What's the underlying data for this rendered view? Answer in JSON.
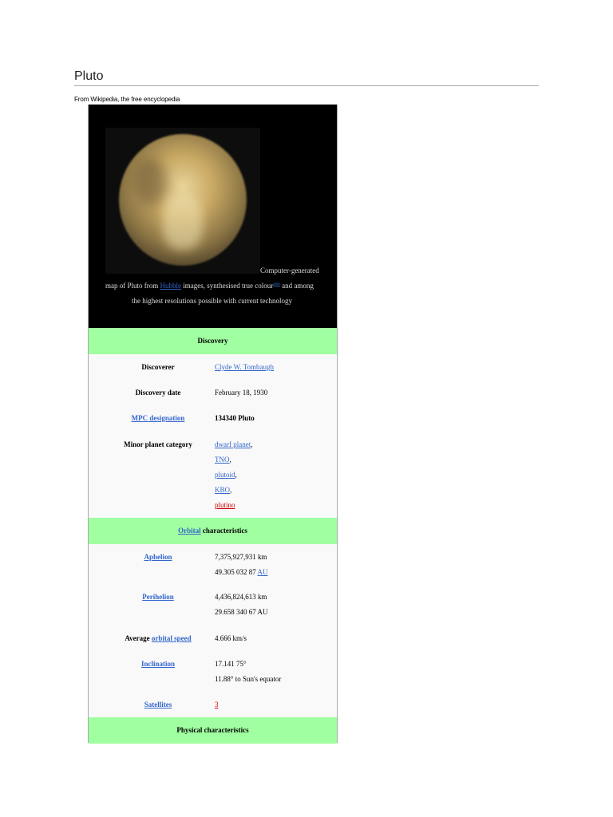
{
  "page": {
    "title": "Pluto",
    "subtitle": "From Wikipedia, the free encyclopedia"
  },
  "infobox": {
    "caption": {
      "line1": "Computer-generated",
      "line2_pre": "map of Pluto from ",
      "hubble": "Hubble",
      "line2_mid": " images, synthesised true colour",
      "note": "note",
      "line2_post": " and among",
      "line3": "the highest resolutions possible with current technology"
    },
    "discovery": {
      "header": "Discovery",
      "discoverer_label": "Discoverer",
      "discoverer": "Clyde W. Tombaugh",
      "date_label": "Discovery date",
      "date": "February 18, 1930",
      "mpc_label": "MPC designation",
      "mpc": "134340 Pluto",
      "category_label": "Minor planet category",
      "categories": [
        "dwarf planet",
        "TNO",
        "plutoid",
        "KBO",
        "plutino"
      ]
    },
    "orbital": {
      "header_link": "Orbital",
      "header_rest": " characteristics",
      "aphelion_label": "Aphelion",
      "aphelion_km": "7,375,927,931 km",
      "aphelion_au": "49.305 032 87",
      "au": "AU",
      "perihelion_label": "Perihelion",
      "perihelion_km": "4,436,824,613 km",
      "perihelion_au": "29.658 340 67 AU",
      "speed_label_pre": "Average ",
      "speed_label_link": "orbital speed",
      "speed": "4.666 km/s",
      "inclination_label": "Inclination",
      "inclination": "17.141 75°",
      "inclination2": "11.88° to Sun's equator",
      "satellites_label": "Satellites",
      "satellites": "3"
    },
    "physical": {
      "header": "Physical characteristics"
    }
  }
}
